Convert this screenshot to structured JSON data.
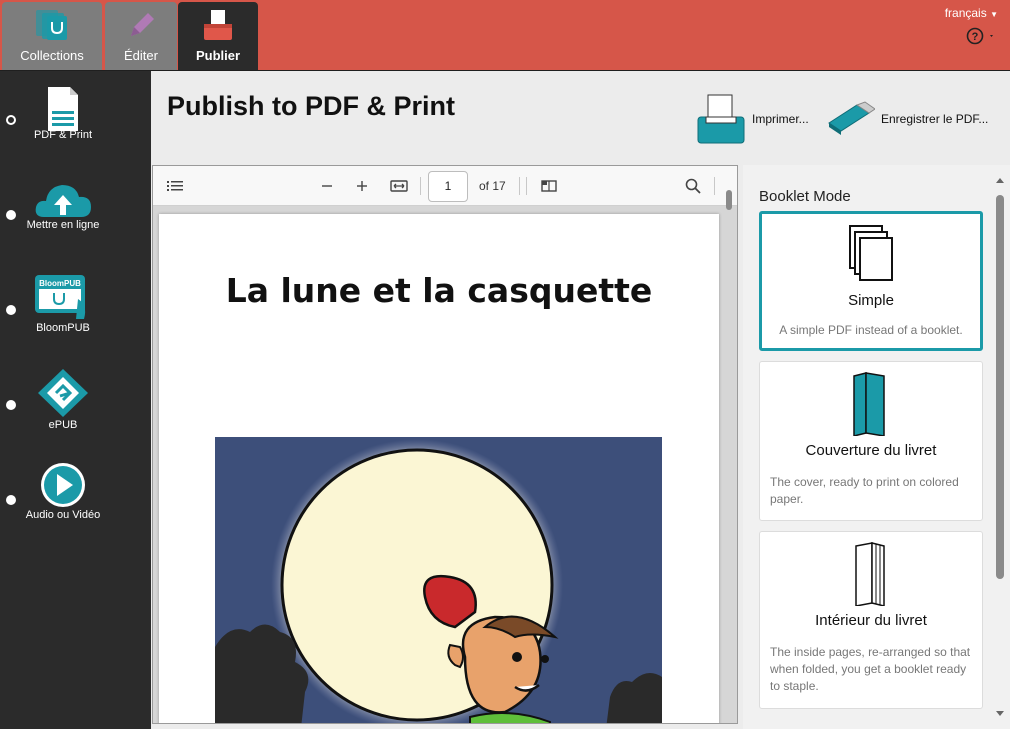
{
  "topbar": {
    "tabs": [
      {
        "label": "Collections",
        "icon": "collections-icon"
      },
      {
        "label": "Éditer",
        "icon": "pencil-icon"
      },
      {
        "label": "Publier",
        "icon": "publish-icon"
      }
    ],
    "language": "français",
    "colors": {
      "bar": "#d65649",
      "active_tab": "#2b2b2b",
      "inactive_tab": "#7d7d7d"
    }
  },
  "sidebar": {
    "items": [
      {
        "label": "PDF & Print",
        "icon": "pdf-document-icon",
        "selected": true
      },
      {
        "label": "Mettre en ligne",
        "icon": "cloud-upload-icon",
        "selected": false
      },
      {
        "label": "BloomPUB",
        "icon": "bloompub-icon",
        "badge": "BloomPUB",
        "selected": false
      },
      {
        "label": "ePUB",
        "icon": "epub-icon",
        "selected": false
      },
      {
        "label": "Audio ou Vidéo",
        "icon": "play-icon",
        "selected": false
      }
    ]
  },
  "main": {
    "title": "Publish to PDF & Print",
    "actions": {
      "print_label": "Imprimer...",
      "save_label": "Enregistrer le PDF..."
    }
  },
  "viewer": {
    "current_page": "1",
    "page_count_label": "of 17",
    "book_title": "La lune et la casquette"
  },
  "booklet": {
    "heading": "Booklet Mode",
    "options": [
      {
        "title": "Simple",
        "description": "A simple PDF instead of a booklet.",
        "selected": true
      },
      {
        "title": "Couverture du livret",
        "description": "The cover, ready to print on colored paper.",
        "selected": false
      },
      {
        "title": "Intérieur du livret",
        "description": "The inside pages, re-arranged so that when folded, you get a booklet ready to staple.",
        "selected": false
      }
    ],
    "accent": "#1b9aa8"
  }
}
